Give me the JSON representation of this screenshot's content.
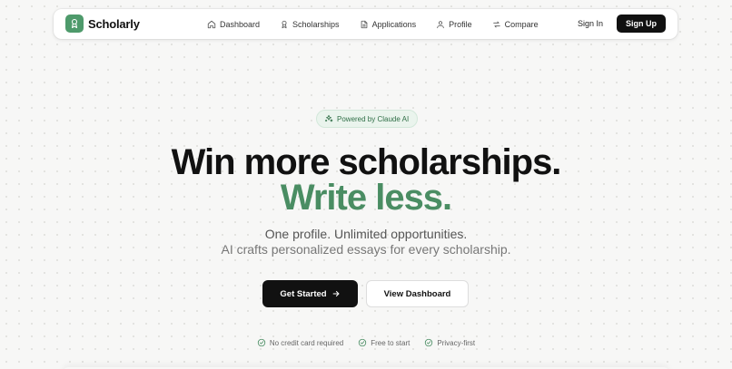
{
  "brand": {
    "name": "Scholarly",
    "color": "#4e9a6b"
  },
  "nav": {
    "items": [
      {
        "label": "Dashboard",
        "icon": "home-icon"
      },
      {
        "label": "Scholarships",
        "icon": "award-icon"
      },
      {
        "label": "Applications",
        "icon": "file-text-icon"
      },
      {
        "label": "Profile",
        "icon": "user-icon"
      },
      {
        "label": "Compare",
        "icon": "compare-arrows-icon"
      }
    ],
    "sign_in": "Sign In",
    "sign_up": "Sign Up"
  },
  "hero": {
    "badge": "Powered by Claude AI",
    "badge_icon": "sparkles-icon",
    "title_line1": "Win more scholarships.",
    "title_line2": "Write less.",
    "accent_color": "#4a8d63",
    "subtitle_line1": "One profile. Unlimited opportunities.",
    "subtitle_line2": "AI crafts personalized essays for every scholarship.",
    "primary_cta": "Get Started",
    "secondary_cta": "View Dashboard"
  },
  "features": [
    {
      "label": "No credit card required",
      "icon": "check-circle-icon"
    },
    {
      "label": "Free to start",
      "icon": "check-circle-icon"
    },
    {
      "label": "Privacy-first",
      "icon": "check-circle-icon"
    }
  ]
}
